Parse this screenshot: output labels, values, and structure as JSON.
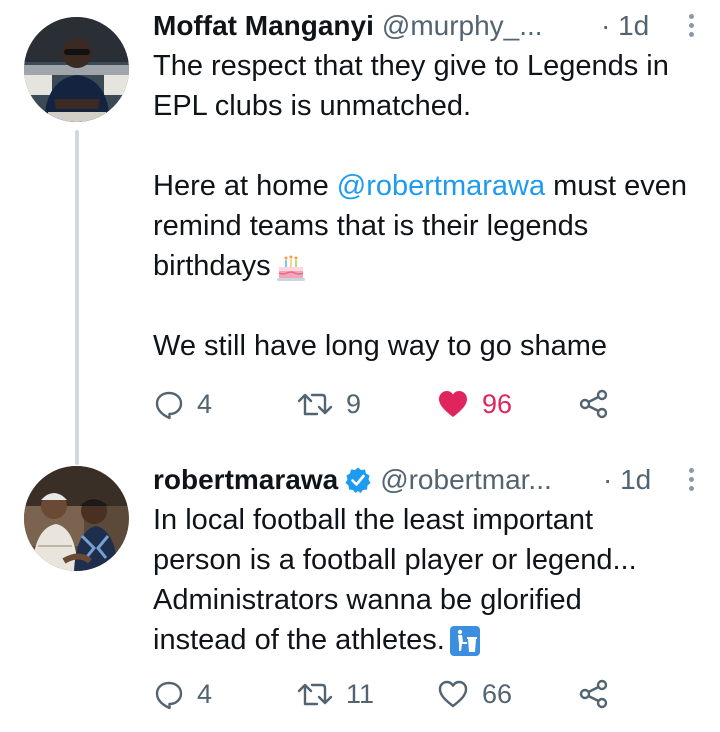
{
  "colors": {
    "mention": "#1d9bf0",
    "secondary_text": "#536471",
    "like_active": "#e0245e",
    "verified": "#1d9bf0",
    "thread_line": "#cfd9de"
  },
  "tweets": [
    {
      "name": "Moffat Manganyi",
      "handle": "@murphy_...",
      "time": "· 1d",
      "verified": false,
      "body": {
        "line1": "The respect that they give to Legends in",
        "line2": "EPL clubs is unmatched.",
        "line3_prefix": "Here at home ",
        "mention": "@robertmarawa",
        "line3_suffix": " must even",
        "line4": "remind teams that is their legends",
        "line5": "birthdays",
        "emoji": "birthday-cake-icon",
        "line6": "We still have long way to go shame"
      },
      "replies": "4",
      "retweets": "9",
      "likes": "96",
      "liked": true
    },
    {
      "name": "robertmarawa",
      "handle": "@robertmar...",
      "time": "· 1d",
      "verified": true,
      "body": {
        "line1": "In local football the least important",
        "line2": "person is a football player or legend...",
        "line3": "Administrators wanna be glorified",
        "line4": "instead of the athletes.",
        "emoji": "litter-in-bin-icon"
      },
      "replies": "4",
      "retweets": "11",
      "likes": "66",
      "liked": false
    }
  ]
}
